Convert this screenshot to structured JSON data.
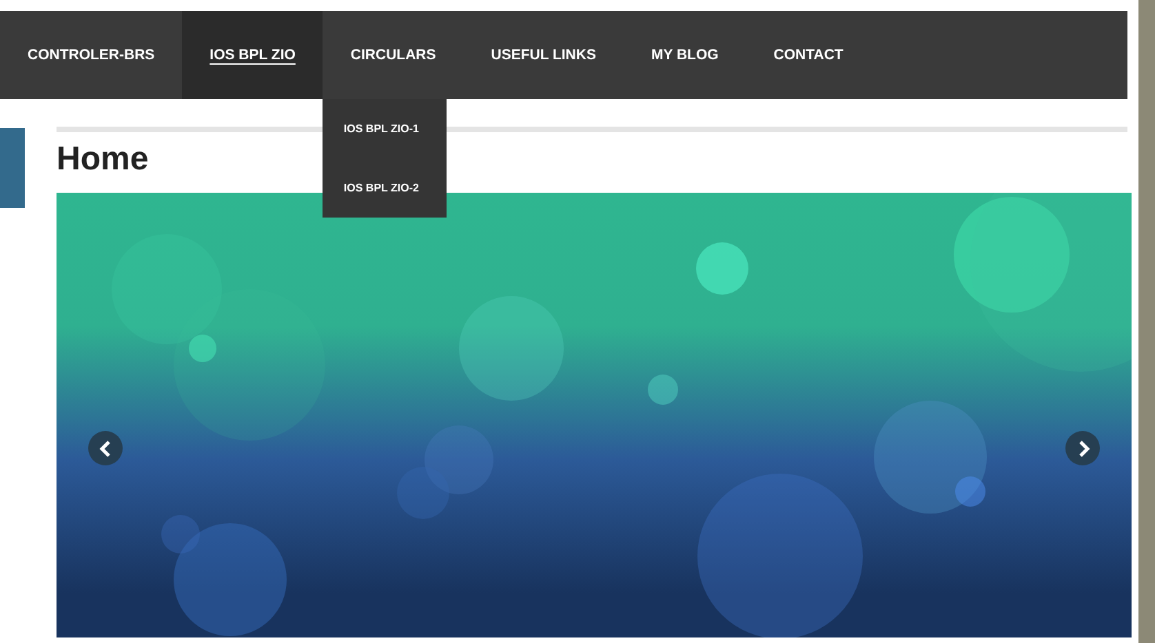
{
  "nav": {
    "items": [
      {
        "label": "CONTROLER-BRS",
        "selected": false
      },
      {
        "label": "IOS BPL ZIO",
        "selected": true
      },
      {
        "label": "CIRCULARS",
        "selected": false,
        "expanded": true,
        "submenu": [
          "IOS BPL ZIO-1",
          "IOS BPL ZIO-2"
        ]
      },
      {
        "label": "USEFUL LINKS",
        "selected": false
      },
      {
        "label": "MY BLOG",
        "selected": false
      },
      {
        "label": "CONTACT",
        "selected": false
      }
    ]
  },
  "page": {
    "title": "Home"
  }
}
